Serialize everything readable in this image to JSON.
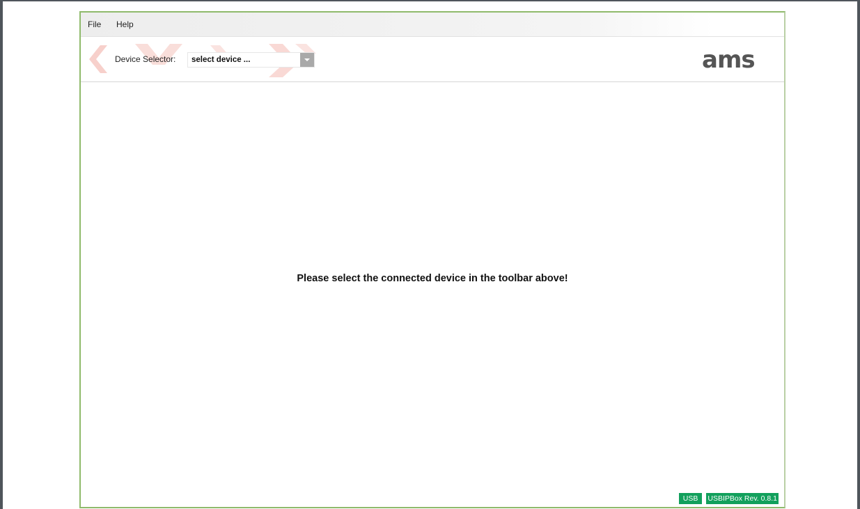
{
  "menu": {
    "file": "File",
    "help": "Help"
  },
  "toolbar": {
    "device_selector_label": "Device Selector:",
    "device_selector_value": "select device ...",
    "logo_text": "ams"
  },
  "main": {
    "message": "Please select the connected device in the toolbar above!"
  },
  "status": {
    "connection": "USB",
    "revision": "USBIPBox Rev. 0.8.1"
  },
  "colors": {
    "status_badge": "#12a05c",
    "window_border": "#8fba6b",
    "watermark": "#f6cbc6",
    "logo": "#555555"
  }
}
